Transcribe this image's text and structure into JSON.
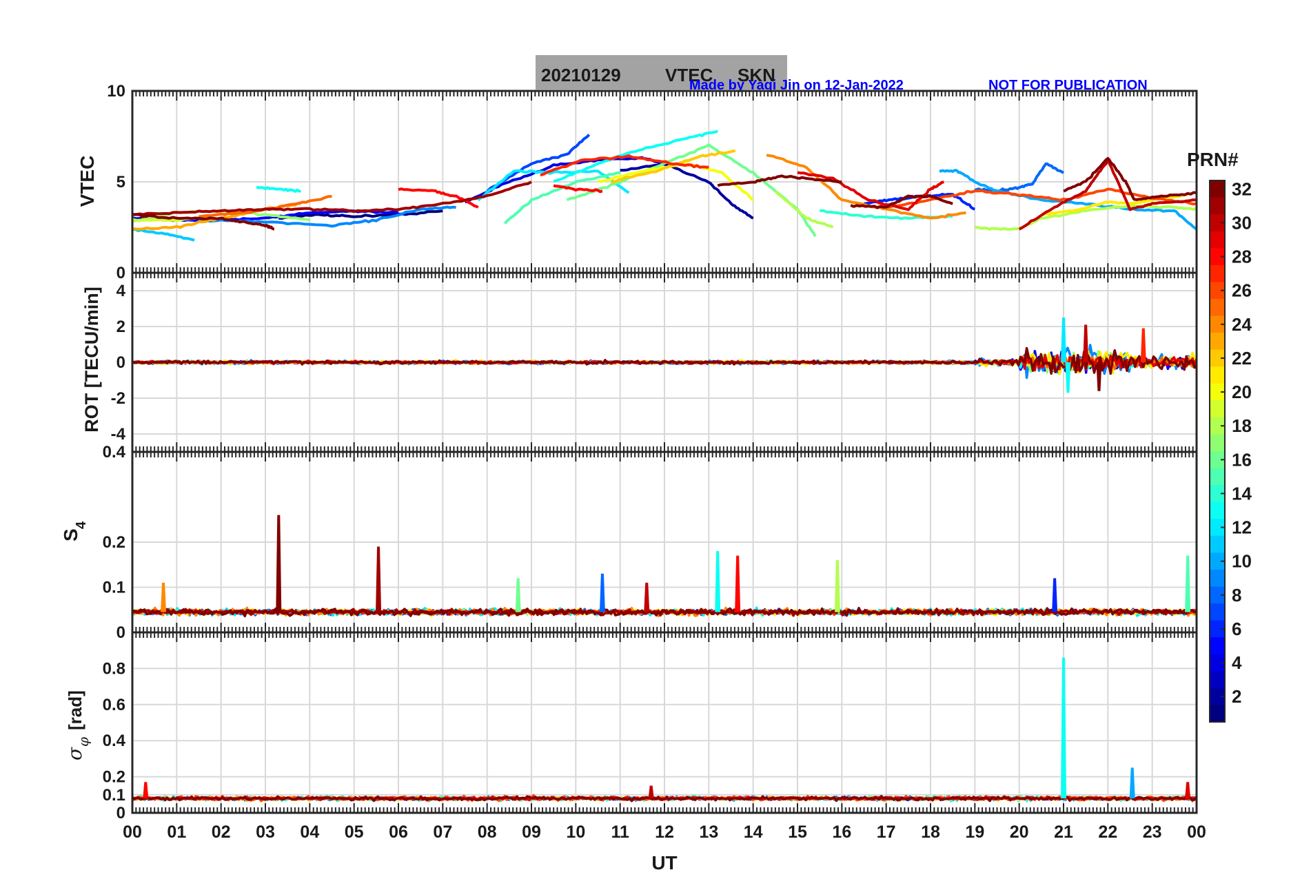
{
  "title": {
    "date": "20210129",
    "product": "VTEC",
    "station": "SKN",
    "box_color": "#a3a3a3"
  },
  "credit": "Made by Yaqi Jin on 12-Jan-2022",
  "notice": "NOT FOR PUBLICATION",
  "credit_color": "#0000ff",
  "x_axis": {
    "label": "UT",
    "tick_labels": [
      "00",
      "01",
      "02",
      "03",
      "04",
      "05",
      "06",
      "07",
      "08",
      "09",
      "10",
      "11",
      "12",
      "13",
      "14",
      "15",
      "16",
      "17",
      "18",
      "19",
      "20",
      "21",
      "22",
      "23",
      "00"
    ]
  },
  "colorbar": {
    "label": "PRN#",
    "ticks": [
      "2",
      "4",
      "6",
      "8",
      "10",
      "12",
      "14",
      "16",
      "18",
      "20",
      "22",
      "24",
      "26",
      "28",
      "30",
      "32"
    ],
    "range": [
      1,
      32
    ],
    "colormap": "jet"
  },
  "chart_data": [
    {
      "type": "line",
      "id": "vtec",
      "ylabel": "VTEC",
      "ylim": [
        0,
        10
      ],
      "yticks": [
        "0",
        "5",
        "10"
      ],
      "series": [
        {
          "prn": 1,
          "x": [
            3.3,
            4.2,
            5.0,
            6.0,
            7.0
          ],
          "y": [
            3.0,
            3.2,
            3.1,
            3.2,
            3.4
          ]
        },
        {
          "prn": 2,
          "x": [
            11.0,
            12.0,
            13.0,
            13.5,
            14.0
          ],
          "y": [
            5.6,
            6.0,
            5.0,
            3.8,
            3.0
          ]
        },
        {
          "prn": 4,
          "x": [
            7.5,
            8.5,
            9.5,
            10.5,
            11.5,
            12.0
          ],
          "y": [
            3.9,
            5.0,
            5.9,
            6.2,
            6.3,
            6.0
          ]
        },
        {
          "prn": 5,
          "x": [
            0.0,
            1.0,
            2.0,
            3.0,
            4.0,
            5.0,
            6.0
          ],
          "y": [
            3.0,
            2.9,
            2.9,
            3.0,
            3.3,
            3.4,
            3.3
          ]
        },
        {
          "prn": 6,
          "x": [
            16.5,
            17.0,
            17.8,
            18.5,
            19.0
          ],
          "y": [
            3.8,
            4.0,
            4.2,
            4.3,
            3.5
          ]
        },
        {
          "prn": 7,
          "x": [
            8.0,
            9.0,
            9.8,
            10.3
          ],
          "y": [
            4.5,
            6.0,
            6.5,
            7.6
          ]
        },
        {
          "prn": 8,
          "x": [
            19.0,
            19.5,
            20.0,
            20.3,
            20.6,
            21.0
          ],
          "y": [
            4.6,
            4.5,
            4.7,
            4.9,
            6.0,
            5.5
          ]
        },
        {
          "prn": 9,
          "x": [
            1.5,
            3.0,
            4.5,
            5.5,
            6.5,
            7.3
          ],
          "y": [
            2.9,
            2.8,
            2.6,
            2.9,
            3.5,
            3.6
          ]
        },
        {
          "prn": 10,
          "x": [
            18.2,
            18.6,
            19.0,
            19.5,
            20.5,
            21.5,
            22.5,
            23.5,
            24.0
          ],
          "y": [
            5.6,
            5.6,
            5.0,
            4.5,
            4.0,
            3.8,
            3.5,
            3.4,
            2.4
          ]
        },
        {
          "prn": 11,
          "x": [
            0.0,
            0.8,
            1.4
          ],
          "y": [
            2.4,
            2.1,
            1.8
          ]
        },
        {
          "prn": 12,
          "x": [
            7.8,
            8.6,
            9.5,
            10.5,
            11.2
          ],
          "y": [
            4.0,
            5.6,
            5.5,
            5.6,
            4.4
          ]
        },
        {
          "prn": 13,
          "x": [
            2.8,
            3.3,
            3.8
          ],
          "y": [
            4.7,
            4.6,
            4.5
          ]
        },
        {
          "prn": 13,
          "x": [
            9.5,
            10.5,
            11.5,
            12.5,
            13.2
          ],
          "y": [
            5.0,
            6.0,
            6.8,
            7.4,
            7.8
          ]
        },
        {
          "prn": 14,
          "x": [
            15.5,
            16.5,
            17.5,
            18.5
          ],
          "y": [
            3.4,
            3.1,
            3.0,
            3.1
          ]
        },
        {
          "prn": 15,
          "x": [
            8.4,
            9.0,
            10.0,
            11.0
          ],
          "y": [
            2.7,
            4.0,
            5.0,
            5.5
          ]
        },
        {
          "prn": 16,
          "x": [
            9.8,
            10.8,
            12.0,
            13.0,
            14.0,
            15.0,
            15.4
          ],
          "y": [
            4.0,
            4.8,
            6.0,
            7.0,
            5.5,
            3.5,
            2.0
          ]
        },
        {
          "prn": 17,
          "x": [
            0.0,
            1.0,
            2.0,
            3.0,
            4.0
          ],
          "y": [
            2.8,
            3.3,
            3.4,
            3.2,
            2.9
          ]
        },
        {
          "prn": 18,
          "x": [
            14.5,
            15.2,
            15.8
          ],
          "y": [
            4.5,
            3.0,
            2.5
          ]
        },
        {
          "prn": 18,
          "x": [
            19.0,
            19.5,
            20.0,
            20.5,
            21.5,
            22.5,
            23.5,
            24.0
          ],
          "y": [
            2.5,
            2.4,
            2.4,
            3.0,
            3.4,
            3.7,
            3.6,
            3.5
          ]
        },
        {
          "prn": 19,
          "x": [
            0.0,
            1.0,
            2.0,
            3.0
          ],
          "y": [
            2.9,
            2.9,
            3.2,
            3.5
          ]
        },
        {
          "prn": 20,
          "x": [
            10.5,
            11.5,
            12.5,
            13.3,
            14.0
          ],
          "y": [
            5.0,
            5.6,
            6.0,
            5.5,
            4.0
          ]
        },
        {
          "prn": 21,
          "x": [
            20.5,
            21.2,
            22.0,
            22.5,
            23.0,
            23.8
          ],
          "y": [
            3.2,
            3.4,
            3.9,
            3.8,
            4.0,
            4.3
          ]
        },
        {
          "prn": 22,
          "x": [
            10.8,
            11.8,
            12.8,
            13.6
          ],
          "y": [
            5.0,
            5.6,
            6.4,
            6.7
          ]
        },
        {
          "prn": 23,
          "x": [
            0.0,
            1.0,
            2.0,
            3.0,
            3.8
          ],
          "y": [
            2.4,
            2.5,
            3.0,
            3.5,
            3.8
          ]
        },
        {
          "prn": 24,
          "x": [
            14.3,
            15.2,
            16.0,
            17.0,
            18.0,
            18.8
          ],
          "y": [
            6.5,
            5.8,
            4.0,
            3.5,
            3.0,
            3.3
          ]
        },
        {
          "prn": 25,
          "x": [
            1.5,
            2.5,
            3.5,
            4.5
          ],
          "y": [
            3.1,
            3.3,
            3.7,
            4.2
          ]
        },
        {
          "prn": 26,
          "x": [
            17.0,
            18.0,
            19.0,
            20.0,
            21.0,
            22.0,
            23.0,
            24.0
          ],
          "y": [
            3.6,
            4.0,
            4.5,
            4.3,
            4.0,
            4.6,
            4.1,
            3.8
          ]
        },
        {
          "prn": 27,
          "x": [
            9.2,
            10.2,
            11.2,
            12.2,
            13.0
          ],
          "y": [
            5.4,
            6.2,
            6.4,
            6.0,
            5.8
          ]
        },
        {
          "prn": 28,
          "x": [
            6.0,
            6.8,
            7.3,
            7.8
          ],
          "y": [
            4.6,
            4.5,
            4.2,
            3.6
          ]
        },
        {
          "prn": 28,
          "x": [
            9.5,
            10.0,
            10.6
          ],
          "y": [
            4.8,
            4.6,
            4.5
          ]
        },
        {
          "prn": 29,
          "x": [
            15.0,
            15.8,
            16.6,
            17.5,
            18.0,
            18.3
          ],
          "y": [
            5.5,
            5.2,
            4.0,
            3.5,
            4.6,
            5.0
          ]
        },
        {
          "prn": 30,
          "x": [
            20.0,
            20.8,
            21.5,
            22.0,
            22.5,
            23.0,
            24.0
          ],
          "y": [
            2.4,
            3.6,
            4.5,
            6.2,
            3.5,
            3.8,
            4.0
          ]
        },
        {
          "prn": 31,
          "x": [
            0.0,
            1.0,
            2.0,
            3.0,
            4.0,
            5.0,
            6.0,
            7.0,
            8.0,
            9.0
          ],
          "y": [
            3.2,
            3.3,
            3.4,
            3.5,
            3.5,
            3.4,
            3.5,
            3.8,
            4.2,
            5.0
          ]
        },
        {
          "prn": 32,
          "x": [
            0.0,
            1.0,
            2.0,
            2.5,
            3.0,
            3.2
          ],
          "y": [
            3.2,
            3.0,
            3.0,
            2.8,
            2.6,
            2.4
          ]
        },
        {
          "prn": 32,
          "x": [
            13.2,
            14.0,
            14.6,
            15.2,
            16.0
          ],
          "y": [
            4.8,
            5.0,
            5.3,
            5.2,
            5.0
          ]
        },
        {
          "prn": 32,
          "x": [
            16.2,
            17.0,
            17.5,
            18.0,
            18.5
          ],
          "y": [
            3.7,
            3.6,
            4.2,
            4.2,
            3.8
          ]
        },
        {
          "prn": 32,
          "x": [
            21.0,
            21.5,
            22.0,
            22.4,
            22.6,
            23.2,
            24.0
          ],
          "y": [
            4.5,
            5.0,
            6.3,
            5.0,
            4.0,
            4.2,
            4.4
          ]
        }
      ]
    },
    {
      "type": "line",
      "id": "rot",
      "ylabel": "ROT [TECU/min]",
      "ylim": [
        -5,
        5
      ],
      "yticks": [
        "-4",
        "-2",
        "0",
        "2",
        "4"
      ],
      "baseline": 0,
      "noise_level": [
        {
          "from": 0,
          "to": 19,
          "amplitude": 0.15
        },
        {
          "from": 19,
          "to": 20,
          "amplitude": 0.3
        },
        {
          "from": 20,
          "to": 22.5,
          "amplitude": 1.2
        },
        {
          "from": 22.5,
          "to": 24,
          "amplitude": 0.6
        }
      ],
      "series_prns": [
        2,
        5,
        9,
        13,
        17,
        21,
        25,
        29,
        32
      ],
      "peaks": [
        {
          "x": 21.0,
          "y": 2.5,
          "prn": 12
        },
        {
          "x": 21.5,
          "y": 2.1,
          "prn": 30
        },
        {
          "x": 21.1,
          "y": -1.7,
          "prn": 13
        },
        {
          "x": 21.8,
          "y": -1.6,
          "prn": 32
        },
        {
          "x": 22.8,
          "y": 1.9,
          "prn": 27
        }
      ]
    },
    {
      "type": "line",
      "id": "s4",
      "ylabel": "S4",
      "ylim": [
        0,
        0.4
      ],
      "yticks": [
        "0",
        "0.1",
        "0.2",
        "0.4"
      ],
      "baseline": 0.045,
      "noise_level": [
        {
          "from": 0,
          "to": 24,
          "amplitude": 0.012
        }
      ],
      "series_prns": [
        3,
        8,
        12,
        16,
        20,
        24,
        27,
        31,
        32
      ],
      "peaks": [
        {
          "x": 3.3,
          "y": 0.26,
          "prn": 32
        },
        {
          "x": 5.55,
          "y": 0.19,
          "prn": 31
        },
        {
          "x": 13.2,
          "y": 0.18,
          "prn": 13
        },
        {
          "x": 13.65,
          "y": 0.17,
          "prn": 28
        },
        {
          "x": 15.9,
          "y": 0.16,
          "prn": 18
        },
        {
          "x": 23.8,
          "y": 0.17,
          "prn": 15
        },
        {
          "x": 10.6,
          "y": 0.13,
          "prn": 8
        },
        {
          "x": 8.7,
          "y": 0.12,
          "prn": 16
        },
        {
          "x": 0.7,
          "y": 0.11,
          "prn": 24
        },
        {
          "x": 20.8,
          "y": 0.12,
          "prn": 6
        },
        {
          "x": 11.6,
          "y": 0.11,
          "prn": 30
        }
      ]
    },
    {
      "type": "line",
      "id": "sigma_phi",
      "ylabel": "σφ [rad]",
      "ylim": [
        0,
        1
      ],
      "yticks": [
        "0",
        "0.1",
        "0.2",
        "0.4",
        "0.6",
        "0.8"
      ],
      "baseline": 0.08,
      "noise_level": [
        {
          "from": 0,
          "to": 24,
          "amplitude": 0.02
        }
      ],
      "series_prns": [
        4,
        9,
        14,
        19,
        23,
        26,
        29,
        32
      ],
      "peaks": [
        {
          "x": 21.0,
          "y": 0.86,
          "prn": 13
        },
        {
          "x": 22.55,
          "y": 0.25,
          "prn": 10
        },
        {
          "x": 0.3,
          "y": 0.17,
          "prn": 28
        },
        {
          "x": 11.7,
          "y": 0.15,
          "prn": 30
        },
        {
          "x": 23.8,
          "y": 0.17,
          "prn": 29
        }
      ]
    }
  ]
}
